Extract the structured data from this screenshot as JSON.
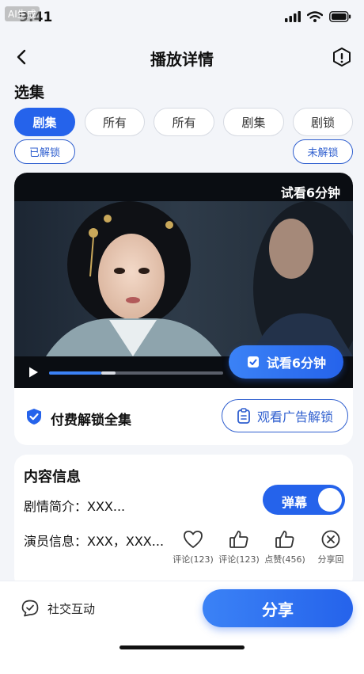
{
  "status": {
    "time": "9:41",
    "watermark": "AI生成"
  },
  "nav": {
    "title": "播放详情"
  },
  "episodes": {
    "title": "选集",
    "chips": [
      "剧集",
      "所有",
      "所有",
      "剧集",
      "剧锁"
    ],
    "unlocked_label": "已解锁",
    "locked_label": "未解锁"
  },
  "player": {
    "badge": "试看6分钟",
    "trial_button": "试看6分钟",
    "progress": 0.3,
    "buffered": 0.38
  },
  "pay": {
    "label": "付费解锁全集",
    "ad_button": "观看广告解锁"
  },
  "content": {
    "title": "内容信息",
    "synopsis": "剧情简介：XXX...",
    "cast": "演员信息：XXX，XXX...",
    "danmaku_label": "弹幕",
    "danmaku_on": true,
    "actions": [
      {
        "icon": "heart-icon",
        "label": "评论(123)"
      },
      {
        "icon": "thumbs-up-icon",
        "label": "评论(123)"
      },
      {
        "icon": "thumbs-up-icon",
        "label": "点赞(456)"
      },
      {
        "icon": "close-circle-icon",
        "label": "分享回"
      }
    ]
  },
  "bottom": {
    "social_label": "社交互动",
    "share_button": "分享"
  },
  "colors": {
    "accent": "#2563eb",
    "outline": "#2f5fcf"
  }
}
